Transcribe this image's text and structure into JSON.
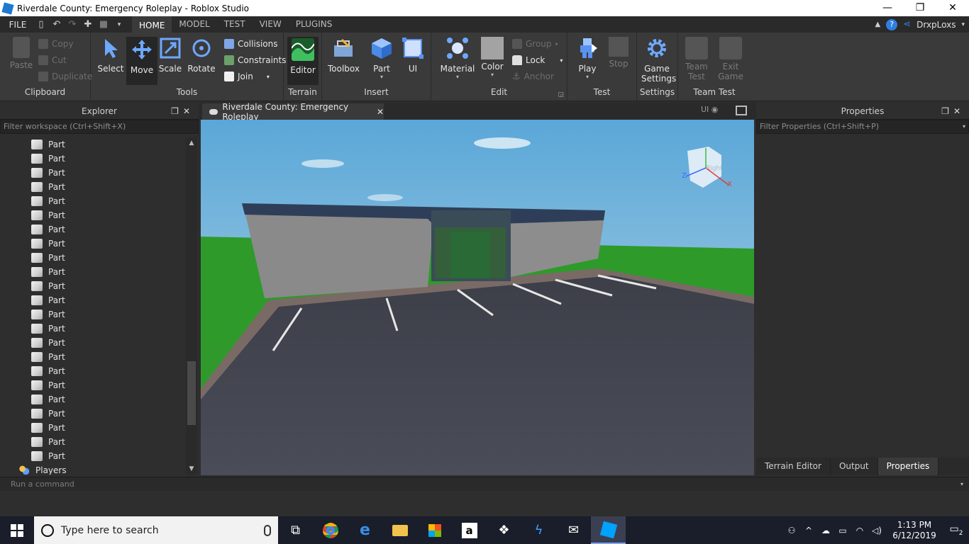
{
  "window": {
    "title": "Riverdale County: Emergency Roleplay - Roblox Studio",
    "controls": {
      "minimize": "—",
      "restore": "❐",
      "close": "✕"
    }
  },
  "menu": {
    "file": "FILE",
    "tabs": [
      "HOME",
      "MODEL",
      "TEST",
      "VIEW",
      "PLUGINS"
    ],
    "active_tab": "HOME",
    "username": "DrxpLoxs"
  },
  "ribbon": {
    "clipboard": {
      "paste": "Paste",
      "copy": "Copy",
      "cut": "Cut",
      "duplicate": "Duplicate",
      "label": "Clipboard"
    },
    "tools": {
      "select": "Select",
      "move": "Move",
      "scale": "Scale",
      "rotate": "Rotate",
      "collisions": "Collisions",
      "constraints": "Constraints",
      "join": "Join",
      "label": "Tools"
    },
    "terrain": {
      "editor": "Editor",
      "label": "Terrain"
    },
    "insert": {
      "toolbox": "Toolbox",
      "part": "Part",
      "ui": "UI",
      "label": "Insert"
    },
    "edit": {
      "material": "Material",
      "color": "Color",
      "group": "Group",
      "lock": "Lock",
      "anchor": "Anchor",
      "label": "Edit"
    },
    "test": {
      "play": "Play",
      "stop": "Stop",
      "label": "Test"
    },
    "settings": {
      "game_settings_1": "Game",
      "game_settings_2": "Settings",
      "label": "Settings"
    },
    "team_test": {
      "team_test_1": "Team",
      "team_test_2": "Test",
      "exit_game_1": "Exit",
      "exit_game_2": "Game",
      "label": "Team Test"
    }
  },
  "explorer": {
    "title": "Explorer",
    "filter_placeholder": "Filter workspace (Ctrl+Shift+X)",
    "items": [
      "Part",
      "Part",
      "Part",
      "Part",
      "Part",
      "Part",
      "Part",
      "Part",
      "Part",
      "Part",
      "Part",
      "Part",
      "Part",
      "Part",
      "Part",
      "Part",
      "Part",
      "Part",
      "Part",
      "Part",
      "Part",
      "Part",
      "Part"
    ],
    "players": "Players"
  },
  "viewport": {
    "tab_title": "Riverdale County: Emergency Roleplay",
    "ui_toggle": "UI",
    "cube_label": "Right",
    "axis_z": "Z",
    "axis_x": "X"
  },
  "properties": {
    "title": "Properties",
    "filter_placeholder": "Filter Properties (Ctrl+Shift+P)",
    "bottom_tabs": [
      "Terrain Editor",
      "Output",
      "Properties"
    ],
    "active_bottom_tab": "Properties"
  },
  "command_bar": {
    "placeholder": "Run a command"
  },
  "taskbar": {
    "search_placeholder": "Type here to search",
    "time": "1:13 PM",
    "date": "6/12/2019",
    "notifications": "2"
  },
  "colors": {
    "accent": "#2f7fe0",
    "ribbon": "#3a3a3a",
    "panel": "#2e2e2e"
  }
}
